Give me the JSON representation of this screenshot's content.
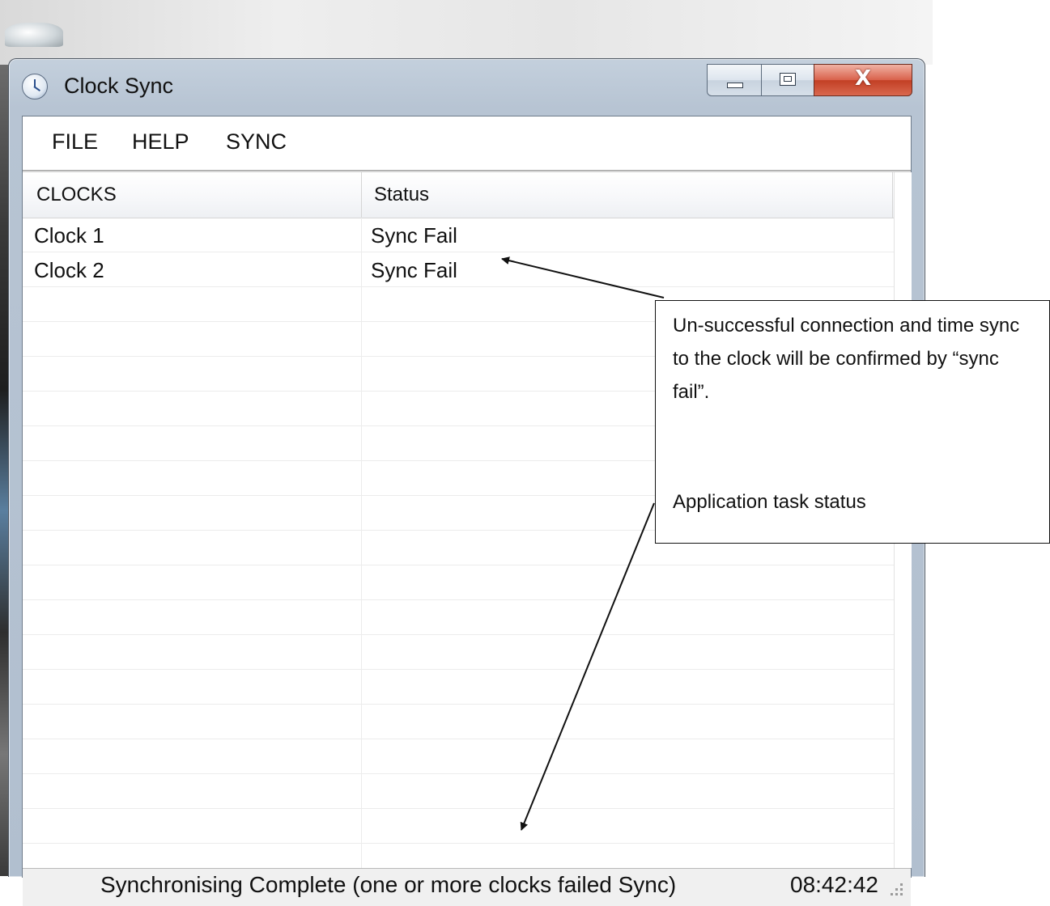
{
  "window": {
    "title": "Clock Sync",
    "close_glyph": "X"
  },
  "menu": {
    "items": [
      "FILE",
      "HELP",
      "SYNC"
    ]
  },
  "list": {
    "columns": [
      "CLOCKS",
      "Status"
    ],
    "rows": [
      {
        "clock": "Clock 1",
        "status": "Sync Fail"
      },
      {
        "clock": "Clock 2",
        "status": "Sync Fail"
      }
    ]
  },
  "statusbar": {
    "message": "Synchronising Complete (one or more clocks failed Sync)",
    "time": "08:42:42"
  },
  "annotation": {
    "text": "Un-successful connection and time sync to the clock will be confirmed by “sync fail”.",
    "task_label": "Application task status"
  },
  "icons": {
    "app": "clock-icon",
    "minimize": "minimize-icon",
    "maximize": "maximize-icon",
    "close": "close-icon",
    "grip": "resize-grip-icon"
  },
  "colors": {
    "close_button": "#c94a31",
    "chrome": "#b7c4d3"
  }
}
